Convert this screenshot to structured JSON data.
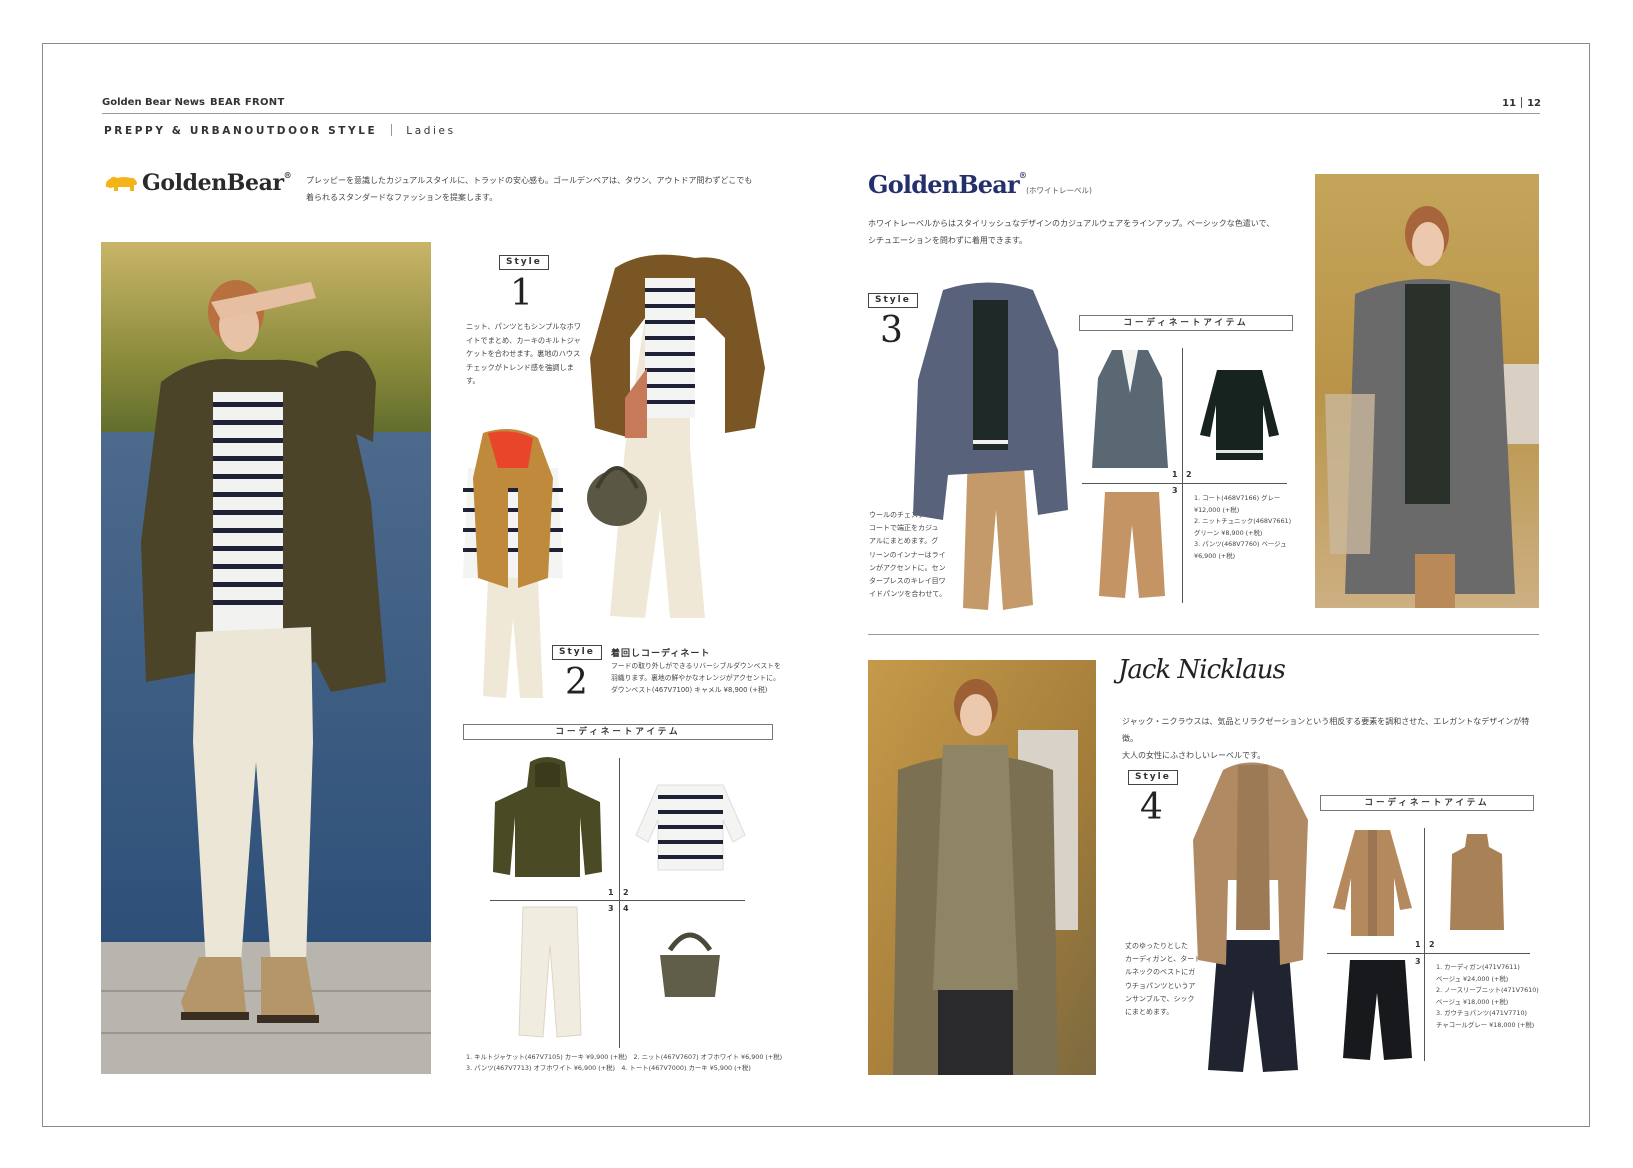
{
  "header": {
    "publication": "Golden Bear News",
    "section_name": "BEAR FRONT",
    "page_left": "11",
    "page_right": "12",
    "theme": "PREPPY & URBANOUTDOOR STYLE",
    "category": "Ladies"
  },
  "left_page": {
    "brand_logo": "GoldenBear",
    "brand_reg": "®",
    "intro": "プレッピーを意識したカジュアルスタイルに、トラッドの安心感も。ゴールデンベアは、タウン、アウトドア問わずどこでも\n着られるスタンダードなファッションを提案します。",
    "style1": {
      "tag": "Style",
      "number": "1",
      "description": "ニット、パンツともシンプルなホワ\nイトでまとめ、カーキのキルトジャ\nケットを合わせます。裏地のハウス\nチェックがトレンド感を強調します。"
    },
    "style2": {
      "tag": "Style",
      "number": "2",
      "title": "着回しコーディネート",
      "description": "フードの取り外しができるリバーシブルダウンベストを\n羽織ります。裏地の鮮やかなオレンジがアクセントに。\nダウンベスト(467V7100) キャメル ¥8,900 (+税)"
    },
    "coordinate_heading": "コーディネートアイテム",
    "grid_numbers": [
      "1",
      "2",
      "3",
      "4"
    ],
    "caption": "1. キルトジャケット(467V7105) カーキ ¥9,900 (+税)　2. ニット(467V7607) オフホワイト ¥6,900 (+税)\n3. パンツ(467V7713) オフホワイト ¥6,900 (+税)　4. トート(467V7000) カーキ ¥5,900 (+税)"
  },
  "right_page": {
    "white_label": {
      "logo": "GoldenBear",
      "reg": "®",
      "sub": "(ホワイトレーベル)",
      "intro": "ホワイトレーベルからはスタイリッシュなデザインのカジュアルウェアをラインアップ。ベーシックな色遣いで、\nシチュエーションを問わずに着用できます。",
      "style3": {
        "tag": "Style",
        "number": "3",
        "description": "ウールのチェスター\nコートで端正をカジュ\nアルにまとめます。グ\nリーンのインナーはライ\nンがアクセントに。セン\nタープレスのキレイ目ワ\nイドパンツを合わせて。"
      },
      "coordinate_heading": "コーディネートアイテム",
      "grid_numbers": [
        "1",
        "2",
        "3"
      ],
      "caption": "1. コート(468V7166) グレー\n¥12,000 (+税)\n2. ニットチュニック(468V7661)\nグリーン ¥8,900 (+税)\n3. パンツ(468V7760) ベージュ\n¥6,900 (+税)"
    },
    "jack_nicklaus": {
      "signature": "Jack Nicklaus",
      "intro": "ジャック・ニクラウスは、気品とリラクゼーションという相反する要素を調和させた、エレガントなデザインが特徴。\n大人の女性にふさわしいレーベルです。",
      "style4": {
        "tag": "Style",
        "number": "4",
        "description": "丈のゆったりとした\nカーディガンと、タート\nルネックのベストにガ\nウチョパンツというア\nンサンブルで、シック\nにまとめます。"
      },
      "coordinate_heading": "コーディネートアイテム",
      "grid_numbers": [
        "1",
        "2",
        "3"
      ],
      "caption": "1. カーディガン(471V7611)\nベージュ ¥24,000 (+税)\n2. ノースリーブニット(471V7610)\nベージュ ¥18,000 (+税)\n3. ガウチョパンツ(471V7710)\nチャコールグレー ¥18,000 (+税)"
    }
  },
  "colors": {
    "logo_gold": "#f2b418",
    "white_label_navy": "#23306b",
    "khaki": "#5a4a2a",
    "camel": "#c48a4a"
  }
}
